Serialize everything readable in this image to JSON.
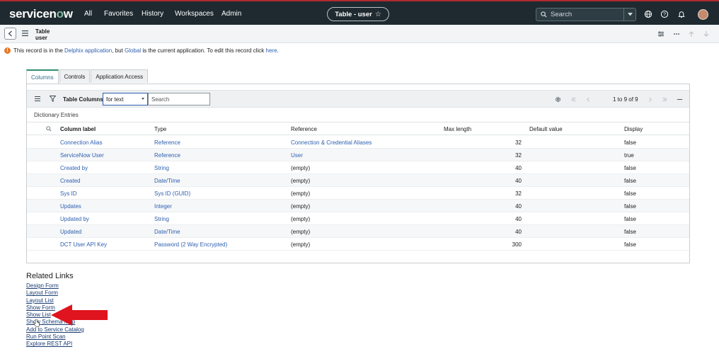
{
  "topbar": {
    "logo": "servicenow",
    "nav": [
      "All",
      "Favorites",
      "History",
      "Workspaces",
      "Admin"
    ],
    "context_pill": "Table - user",
    "search_label": "Search"
  },
  "form_header": {
    "title_line1": "Table",
    "title_line2": "user"
  },
  "notice": {
    "p1": "This record is in the ",
    "link1": "Delphix application",
    "p2": ", but ",
    "link2": "Global",
    "p3": " is the current application. To edit this record click ",
    "link3": "here",
    "p4": "."
  },
  "tabs": [
    "Columns",
    "Controls",
    "Application Access"
  ],
  "list": {
    "title": "Table Columns",
    "filter_field": "for text",
    "search_placeholder": "Search",
    "pagination": "1  to 9 of 9",
    "section": "Dictionary Entries",
    "columns": [
      "Column label",
      "Type",
      "Reference",
      "Max length",
      "Default value",
      "Display"
    ],
    "rows": [
      {
        "label": "Connection Alias",
        "type": "Reference",
        "reference": "Connection & Credential Aliases",
        "max": "32",
        "default": "",
        "display": "false"
      },
      {
        "label": "ServiceNow User",
        "type": "Reference",
        "reference": "User",
        "max": "32",
        "default": "",
        "display": "true"
      },
      {
        "label": "Created by",
        "type": "String",
        "reference": "(empty)",
        "max": "40",
        "default": "",
        "display": "false"
      },
      {
        "label": "Created",
        "type": "Date/Time",
        "reference": "(empty)",
        "max": "40",
        "default": "",
        "display": "false"
      },
      {
        "label": "Sys ID",
        "type": "Sys ID (GUID)",
        "reference": "(empty)",
        "max": "32",
        "default": "",
        "display": "false"
      },
      {
        "label": "Updates",
        "type": "Integer",
        "reference": "(empty)",
        "max": "40",
        "default": "",
        "display": "false"
      },
      {
        "label": "Updated by",
        "type": "String",
        "reference": "(empty)",
        "max": "40",
        "default": "",
        "display": "false"
      },
      {
        "label": "Updated",
        "type": "Date/Time",
        "reference": "(empty)",
        "max": "40",
        "default": "",
        "display": "false"
      },
      {
        "label": "DCT User API Key",
        "type": "Password (2 Way Encrypted)",
        "reference": "(empty)",
        "max": "300",
        "default": "",
        "display": "false"
      }
    ]
  },
  "related_links": {
    "title": "Related Links",
    "links": [
      "Design Form",
      "Layout Form",
      "Layout List",
      "Show Form",
      "Show List",
      "Show Schema Map",
      "Add to Service Catalog",
      "Run Point Scan",
      "Explore REST API"
    ]
  },
  "colors": {
    "topbar_bg": "#1e2a30",
    "link": "#2d5fb0",
    "tab_accent": "#2f8e6f",
    "warning": "#e7792b",
    "annotation_arrow": "#e0141e"
  },
  "icons": {
    "search": "search-icon",
    "globe": "globe-icon",
    "help": "help-icon",
    "bell": "bell-icon",
    "back": "chevron-left-icon",
    "menu": "hamburger-icon",
    "filter": "filter-icon",
    "gear": "gear-icon",
    "warning": "warning-icon"
  }
}
